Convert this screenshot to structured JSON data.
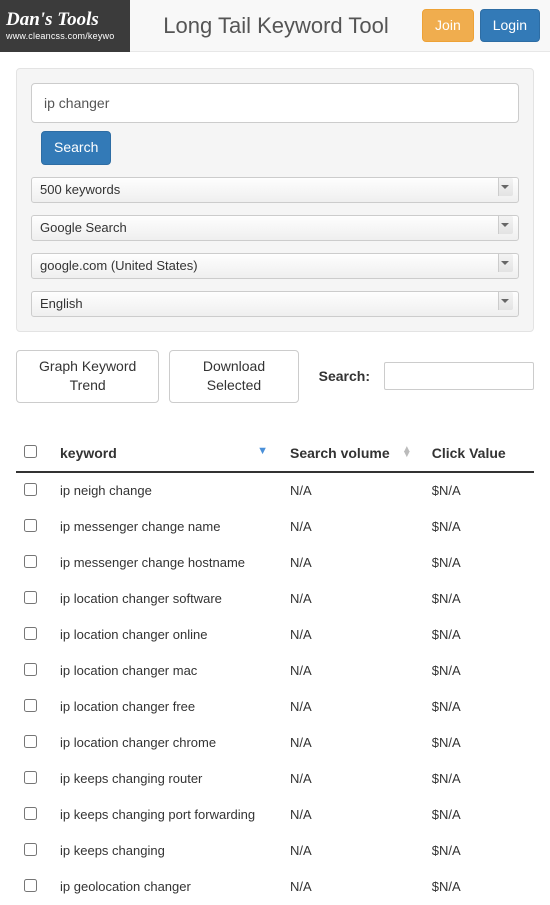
{
  "brand": {
    "title": "Dan's Tools",
    "url": "www.cleancss.com/keywo"
  },
  "header": {
    "page_title": "Long Tail Keyword Tool",
    "join_label": "Join",
    "login_label": "Login"
  },
  "search": {
    "value": "ip changer",
    "button": "Search",
    "limit": "500 keywords",
    "source": "Google Search",
    "region": "google.com (United States)",
    "language": "English"
  },
  "toolbar": {
    "graph_label": "Graph Keyword Trend",
    "download_label": "Download Selected",
    "search_label": "Search:"
  },
  "table": {
    "headers": {
      "keyword": "keyword",
      "volume": "Search volume",
      "click": "Click Value"
    },
    "rows": [
      {
        "keyword": "ip neigh change",
        "volume": "N/A",
        "click": "$N/A"
      },
      {
        "keyword": "ip messenger change name",
        "volume": "N/A",
        "click": "$N/A"
      },
      {
        "keyword": "ip messenger change hostname",
        "volume": "N/A",
        "click": "$N/A"
      },
      {
        "keyword": "ip location changer software",
        "volume": "N/A",
        "click": "$N/A"
      },
      {
        "keyword": "ip location changer online",
        "volume": "N/A",
        "click": "$N/A"
      },
      {
        "keyword": "ip location changer mac",
        "volume": "N/A",
        "click": "$N/A"
      },
      {
        "keyword": "ip location changer free",
        "volume": "N/A",
        "click": "$N/A"
      },
      {
        "keyword": "ip location changer chrome",
        "volume": "N/A",
        "click": "$N/A"
      },
      {
        "keyword": "ip keeps changing router",
        "volume": "N/A",
        "click": "$N/A"
      },
      {
        "keyword": "ip keeps changing port forwarding",
        "volume": "N/A",
        "click": "$N/A"
      },
      {
        "keyword": "ip keeps changing",
        "volume": "N/A",
        "click": "$N/A"
      },
      {
        "keyword": "ip geolocation changer",
        "volume": "N/A",
        "click": "$N/A"
      }
    ]
  }
}
